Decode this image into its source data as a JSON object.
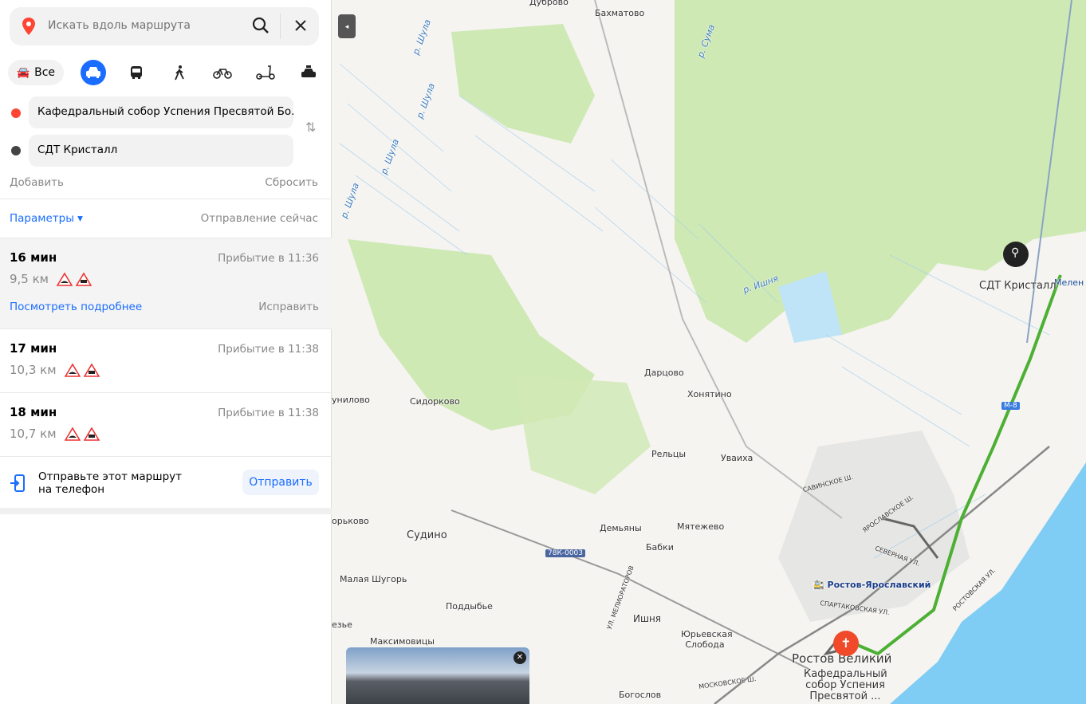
{
  "search": {
    "placeholder": "Искать вдоль маршрута"
  },
  "modes": {
    "all_label": "Все",
    "items": [
      "car",
      "bus",
      "walk",
      "bike",
      "scooter",
      "taxi"
    ]
  },
  "points": {
    "from": "Кафедральный собор Успения Пресвятой Бо...",
    "to": "СДТ Кристалл"
  },
  "actions": {
    "add": "Добавить",
    "reset": "Сбросить"
  },
  "params": {
    "label": "Параметры ▾",
    "departure": "Отправление сейчас"
  },
  "routes": [
    {
      "time": "16 мин",
      "arrival": "Прибытие в 11:36",
      "distance": "9,5 км",
      "details": "Посмотреть подробнее",
      "fix": "Исправить"
    },
    {
      "time": "17 мин",
      "arrival": "Прибытие в 11:38",
      "distance": "10,3 км"
    },
    {
      "time": "18 мин",
      "arrival": "Прибытие в 11:38",
      "distance": "10,7 км"
    }
  ],
  "send": {
    "text1": "Отправьте этот маршрут",
    "text2": "на телефон",
    "button": "Отправить"
  },
  "map": {
    "labels": [
      "Бахматово",
      "Дуброво",
      "р. Сума",
      "р. Шула",
      "р. Шула",
      "р. Шула",
      "р. Шула",
      "р. Ишня",
      "Дарцово",
      "Хонятино",
      "Сидорково",
      "унилово",
      "Рельцы",
      "Уваиха",
      "Судино",
      "Демьяны",
      "Мятежево",
      "Бабки",
      "Малая Шугорь",
      "Поддыбье",
      "Ишня",
      "Юрьевская Слобода",
      "Максимовицы",
      "Богослов",
      "орьково",
      "езье",
      "78К-0003",
      "М-8",
      "САВИНСКОЕ Ш.",
      "ЯРОСЛАВСКОЕ Ш.",
      "СЕВЕРНАЯ УЛ.",
      "РОСТОВСКАЯ УЛ.",
      "СПАРТАКОВСКАЯ УЛ.",
      "МОСКОВСКОЕ Ш.",
      "УЛ. МЕЛИОРАТОРОВ",
      "Мелен"
    ],
    "station": "Ростов-Ярославский",
    "city": "Ростов Великий",
    "dest_label": "СДТ Кристалл",
    "origin_label": "Кафедральный собор Успения Пресвятой ...",
    "route_color": "#4cb034"
  }
}
